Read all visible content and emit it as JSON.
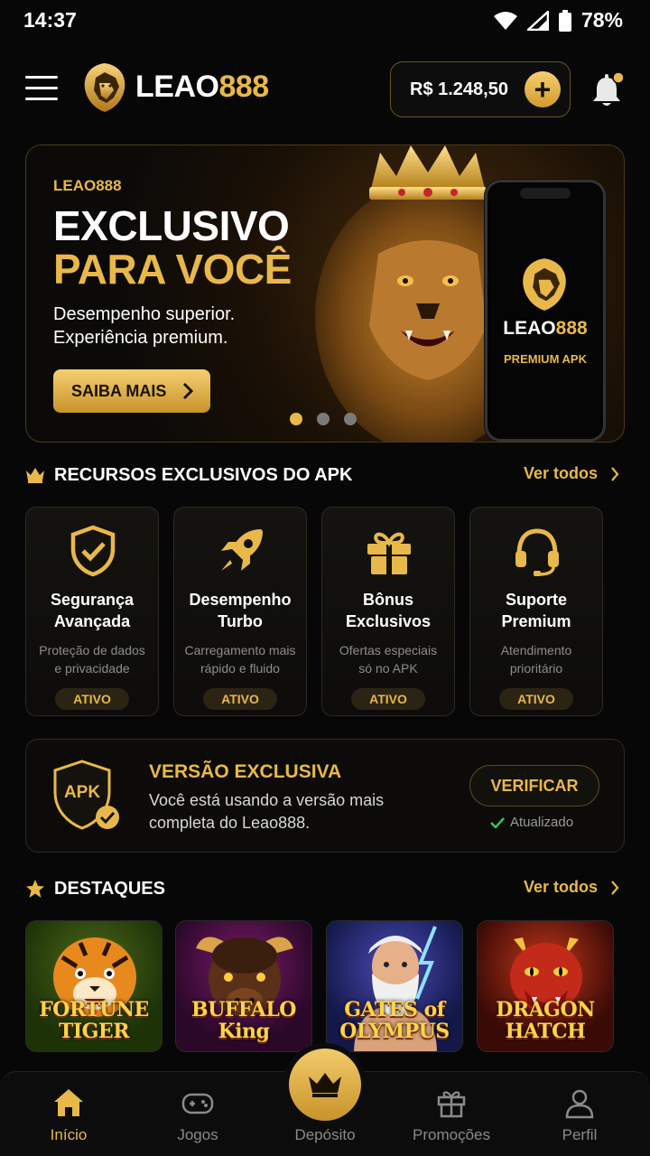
{
  "status_bar": {
    "time": "14:37",
    "battery": "78%",
    "icons": [
      "wifi-icon",
      "signal-icon",
      "battery-icon"
    ]
  },
  "header": {
    "logo": {
      "part1": "LEAO",
      "part2": "888"
    },
    "balance": "R$ 1.248,50",
    "add_funds_symbol": "+",
    "notification_dot": true
  },
  "banner": {
    "brand": "LEAO888",
    "title_line1": "EXCLUSIVO",
    "title_line2": "PARA VOCÊ",
    "desc_line1": "Desempenho superior.",
    "desc_line2": "Experiência premium.",
    "cta": "SAIBA MAIS",
    "phone_brand_part1": "LEAO",
    "phone_brand_part2": "888",
    "phone_tag": "PREMIUM APK",
    "slide_count": 3,
    "active_slide": 1
  },
  "features_section": {
    "title": "RECURSOS EXCLUSIVOS DO APK",
    "see_all": "Ver todos",
    "items": [
      {
        "title_line1": "Segurança",
        "title_line2": "Avançada",
        "desc_line1": "Proteção de dados",
        "desc_line2": "e privacidade",
        "badge": "ATIVO",
        "icon": "shield-check-icon"
      },
      {
        "title_line1": "Desempenho",
        "title_line2": "Turbo",
        "desc_line1": "Carregamento mais",
        "desc_line2": "rápido e fluido",
        "badge": "ATIVO",
        "icon": "rocket-icon"
      },
      {
        "title_line1": "Bônus",
        "title_line2": "Exclusivos",
        "desc_line1": "Ofertas especiais",
        "desc_line2": "só no APK",
        "badge": "ATIVO",
        "icon": "gift-icon"
      },
      {
        "title_line1": "Suporte",
        "title_line2": "Premium",
        "desc_line1": "Atendimento",
        "desc_line2": "prioritário",
        "badge": "ATIVO",
        "icon": "headset-icon"
      }
    ]
  },
  "apk_card": {
    "shield_text": "APK",
    "title": "VERSÃO EXCLUSIVA",
    "desc_line1": "Você está usando a versão mais",
    "desc_line2": "completa do Leao888.",
    "button": "VERIFICAR",
    "status": "Atualizado"
  },
  "highlights_section": {
    "title": "DESTAQUES",
    "see_all": "Ver todos",
    "games": [
      {
        "line1": "FORTUNE",
        "line2": "TIGER"
      },
      {
        "line1": "BUFFALO",
        "line2": "King"
      },
      {
        "line1": "GATES of",
        "line2": "OLYMPUS"
      },
      {
        "line1": "DRAGON",
        "line2": "HATCH"
      }
    ]
  },
  "bottom_nav": {
    "items": [
      {
        "label": "Início",
        "icon": "home-icon",
        "active": true
      },
      {
        "label": "Jogos",
        "icon": "gamepad-icon",
        "active": false
      },
      {
        "label": "Depósito",
        "icon": "crown-icon",
        "active": false
      },
      {
        "label": "Promoções",
        "icon": "gift-icon",
        "active": false
      },
      {
        "label": "Perfil",
        "icon": "user-icon",
        "active": false
      }
    ]
  },
  "colors": {
    "accent": "#e9b84a",
    "background": "#070707",
    "card": "#12110e",
    "muted": "#8a8a8a"
  }
}
